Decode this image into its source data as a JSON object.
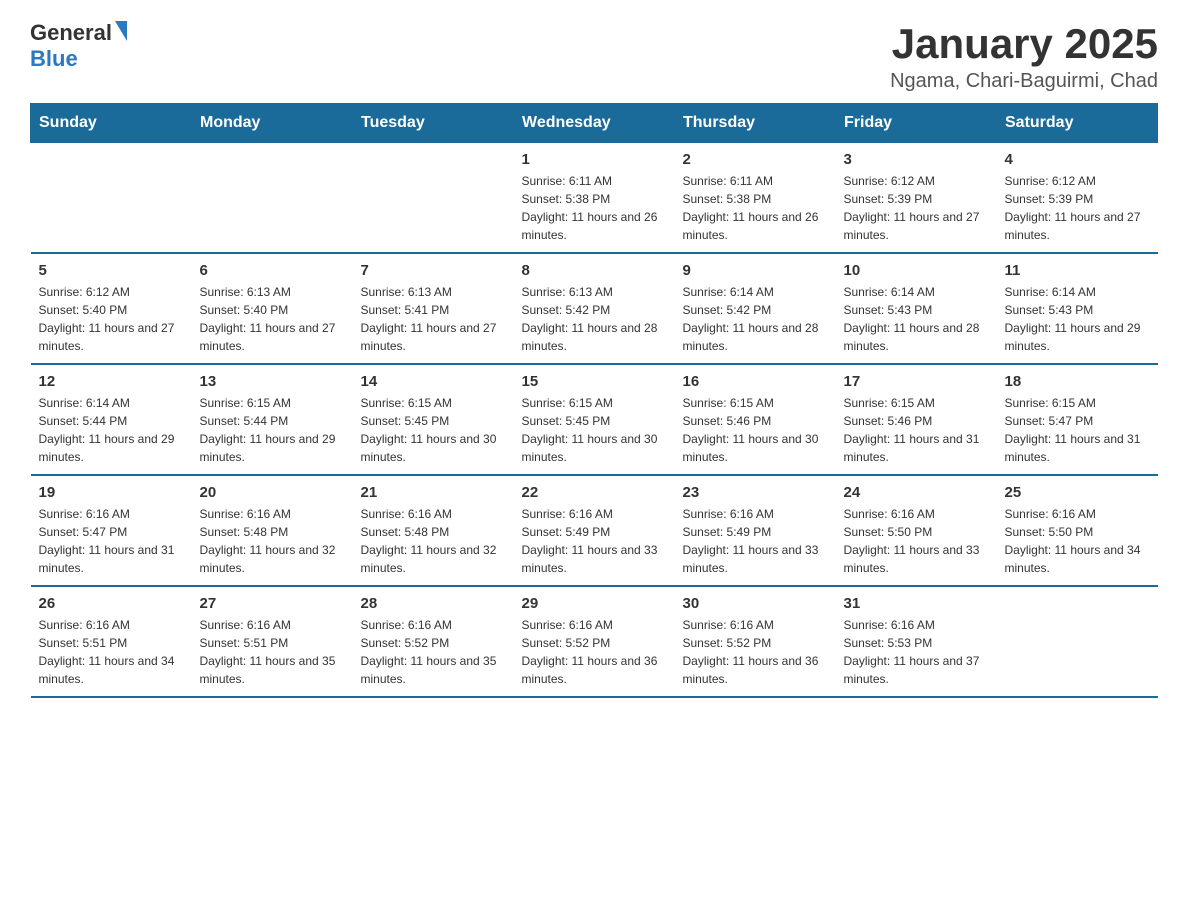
{
  "header": {
    "logo_general": "General",
    "logo_blue": "Blue",
    "title": "January 2025",
    "subtitle": "Ngama, Chari-Baguirmi, Chad"
  },
  "days_of_week": [
    "Sunday",
    "Monday",
    "Tuesday",
    "Wednesday",
    "Thursday",
    "Friday",
    "Saturday"
  ],
  "weeks": [
    [
      {
        "day": "",
        "info": ""
      },
      {
        "day": "",
        "info": ""
      },
      {
        "day": "",
        "info": ""
      },
      {
        "day": "1",
        "info": "Sunrise: 6:11 AM\nSunset: 5:38 PM\nDaylight: 11 hours and 26 minutes."
      },
      {
        "day": "2",
        "info": "Sunrise: 6:11 AM\nSunset: 5:38 PM\nDaylight: 11 hours and 26 minutes."
      },
      {
        "day": "3",
        "info": "Sunrise: 6:12 AM\nSunset: 5:39 PM\nDaylight: 11 hours and 27 minutes."
      },
      {
        "day": "4",
        "info": "Sunrise: 6:12 AM\nSunset: 5:39 PM\nDaylight: 11 hours and 27 minutes."
      }
    ],
    [
      {
        "day": "5",
        "info": "Sunrise: 6:12 AM\nSunset: 5:40 PM\nDaylight: 11 hours and 27 minutes."
      },
      {
        "day": "6",
        "info": "Sunrise: 6:13 AM\nSunset: 5:40 PM\nDaylight: 11 hours and 27 minutes."
      },
      {
        "day": "7",
        "info": "Sunrise: 6:13 AM\nSunset: 5:41 PM\nDaylight: 11 hours and 27 minutes."
      },
      {
        "day": "8",
        "info": "Sunrise: 6:13 AM\nSunset: 5:42 PM\nDaylight: 11 hours and 28 minutes."
      },
      {
        "day": "9",
        "info": "Sunrise: 6:14 AM\nSunset: 5:42 PM\nDaylight: 11 hours and 28 minutes."
      },
      {
        "day": "10",
        "info": "Sunrise: 6:14 AM\nSunset: 5:43 PM\nDaylight: 11 hours and 28 minutes."
      },
      {
        "day": "11",
        "info": "Sunrise: 6:14 AM\nSunset: 5:43 PM\nDaylight: 11 hours and 29 minutes."
      }
    ],
    [
      {
        "day": "12",
        "info": "Sunrise: 6:14 AM\nSunset: 5:44 PM\nDaylight: 11 hours and 29 minutes."
      },
      {
        "day": "13",
        "info": "Sunrise: 6:15 AM\nSunset: 5:44 PM\nDaylight: 11 hours and 29 minutes."
      },
      {
        "day": "14",
        "info": "Sunrise: 6:15 AM\nSunset: 5:45 PM\nDaylight: 11 hours and 30 minutes."
      },
      {
        "day": "15",
        "info": "Sunrise: 6:15 AM\nSunset: 5:45 PM\nDaylight: 11 hours and 30 minutes."
      },
      {
        "day": "16",
        "info": "Sunrise: 6:15 AM\nSunset: 5:46 PM\nDaylight: 11 hours and 30 minutes."
      },
      {
        "day": "17",
        "info": "Sunrise: 6:15 AM\nSunset: 5:46 PM\nDaylight: 11 hours and 31 minutes."
      },
      {
        "day": "18",
        "info": "Sunrise: 6:15 AM\nSunset: 5:47 PM\nDaylight: 11 hours and 31 minutes."
      }
    ],
    [
      {
        "day": "19",
        "info": "Sunrise: 6:16 AM\nSunset: 5:47 PM\nDaylight: 11 hours and 31 minutes."
      },
      {
        "day": "20",
        "info": "Sunrise: 6:16 AM\nSunset: 5:48 PM\nDaylight: 11 hours and 32 minutes."
      },
      {
        "day": "21",
        "info": "Sunrise: 6:16 AM\nSunset: 5:48 PM\nDaylight: 11 hours and 32 minutes."
      },
      {
        "day": "22",
        "info": "Sunrise: 6:16 AM\nSunset: 5:49 PM\nDaylight: 11 hours and 33 minutes."
      },
      {
        "day": "23",
        "info": "Sunrise: 6:16 AM\nSunset: 5:49 PM\nDaylight: 11 hours and 33 minutes."
      },
      {
        "day": "24",
        "info": "Sunrise: 6:16 AM\nSunset: 5:50 PM\nDaylight: 11 hours and 33 minutes."
      },
      {
        "day": "25",
        "info": "Sunrise: 6:16 AM\nSunset: 5:50 PM\nDaylight: 11 hours and 34 minutes."
      }
    ],
    [
      {
        "day": "26",
        "info": "Sunrise: 6:16 AM\nSunset: 5:51 PM\nDaylight: 11 hours and 34 minutes."
      },
      {
        "day": "27",
        "info": "Sunrise: 6:16 AM\nSunset: 5:51 PM\nDaylight: 11 hours and 35 minutes."
      },
      {
        "day": "28",
        "info": "Sunrise: 6:16 AM\nSunset: 5:52 PM\nDaylight: 11 hours and 35 minutes."
      },
      {
        "day": "29",
        "info": "Sunrise: 6:16 AM\nSunset: 5:52 PM\nDaylight: 11 hours and 36 minutes."
      },
      {
        "day": "30",
        "info": "Sunrise: 6:16 AM\nSunset: 5:52 PM\nDaylight: 11 hours and 36 minutes."
      },
      {
        "day": "31",
        "info": "Sunrise: 6:16 AM\nSunset: 5:53 PM\nDaylight: 11 hours and 37 minutes."
      },
      {
        "day": "",
        "info": ""
      }
    ]
  ]
}
